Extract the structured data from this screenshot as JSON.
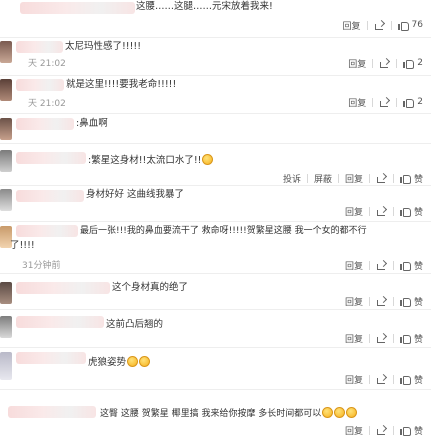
{
  "actions": {
    "reply": "回复",
    "report": "投诉",
    "block": "屏蔽",
    "like_icon": "like-icon",
    "share_icon": "share-icon"
  },
  "comments": [
    {
      "text": "这腰……这腿……元宋放着我来!",
      "time": "",
      "likes": "76"
    },
    {
      "text": "太尼玛性感了!!!!!",
      "time": "天 21:02",
      "likes": "2"
    },
    {
      "text": "就是这里!!!!要我老命!!!!!",
      "time": "天 21:02",
      "likes": "2"
    },
    {
      "text": ":鼻血啊",
      "time": "",
      "likes": ""
    },
    {
      "text": ":繁星这身材!!太流口水了!!",
      "time": "",
      "likes": "赞"
    },
    {
      "text": "身材好好 这曲线我暴了",
      "time": "",
      "likes": "赞"
    },
    {
      "text": "最后一张!!!我的鼻血要流干了 救命呀!!!!!贺繁星这腰 我一个女的都不行",
      "text2": "了!!!!",
      "time": "31分钟前",
      "likes": "赞"
    },
    {
      "text": "这个身材真的绝了",
      "time": "",
      "likes": "赞"
    },
    {
      "text": "这前凸后翘的",
      "time": "",
      "likes": "赞"
    },
    {
      "text": "虎狼姿势",
      "time": "",
      "likes": "赞"
    },
    {
      "text": "这臀 这腰 贺繁星 椰里搞 我来给你按摩 多长时间都可以",
      "time": "",
      "likes": "赞"
    }
  ]
}
